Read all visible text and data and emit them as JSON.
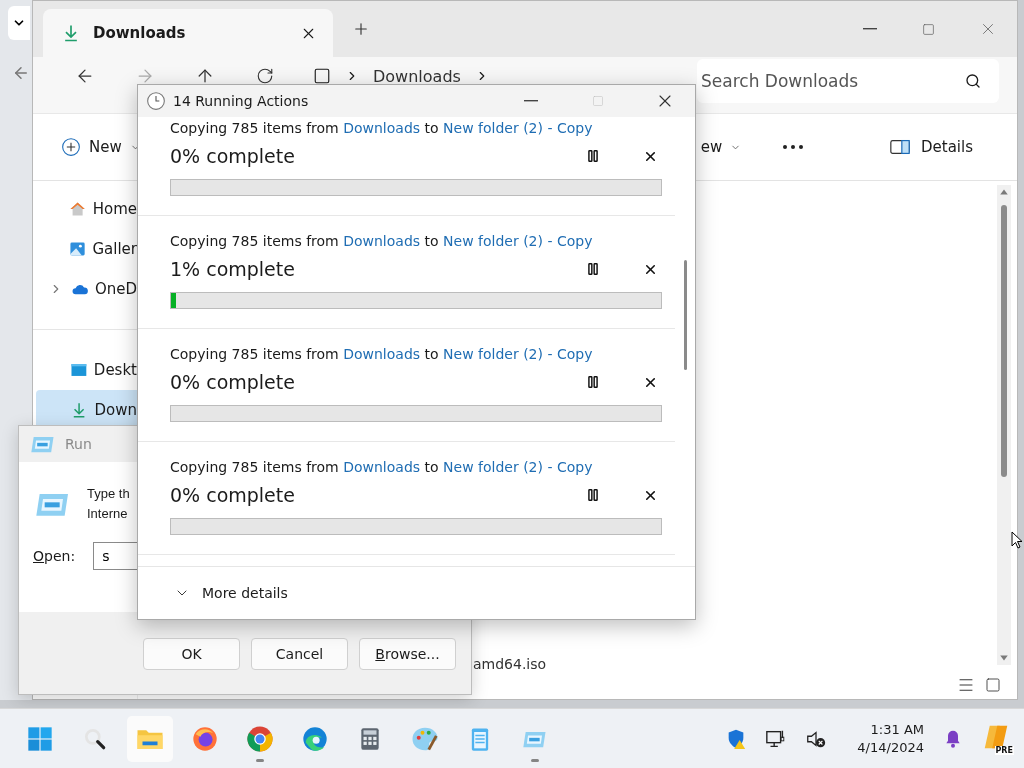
{
  "explorer": {
    "tab": {
      "label": "Downloads",
      "selected": true
    },
    "address": [
      "Downloads"
    ],
    "search": {
      "placeholder": "Search Downloads"
    },
    "commands": [
      {
        "kind": "new",
        "label": "New"
      },
      {
        "kind": "view",
        "label": "ew"
      }
    ],
    "details": "Details",
    "sidebar": {
      "groups": [
        {
          "items": [
            {
              "kind": "home",
              "label": "Home",
              "selected": false,
              "expandable": false
            },
            {
              "kind": "gallery",
              "label": "Galler",
              "selected": false,
              "expandable": false
            },
            {
              "kind": "cloud",
              "label": "OneD",
              "selected": false,
              "expandable": true
            }
          ]
        },
        {
          "items": [
            {
              "kind": "desktop",
              "label": "Deskt",
              "selected": false,
              "expandable": false
            },
            {
              "kind": "downloads",
              "label": "Down",
              "selected": true,
              "expandable": false
            }
          ]
        }
      ]
    },
    "files": [
      {
        "name": "amd64.iso"
      }
    ]
  },
  "run_dialog": {
    "title": "Run",
    "prompt_lines": [
      "Type th",
      "Interne"
    ],
    "open_label": {
      "text": "Open:",
      "first_letter_underlined": true
    },
    "open_value": "s",
    "buttons": [
      {
        "label": "OK"
      },
      {
        "label": "Cancel"
      },
      {
        "label": "Browse...",
        "first_letter_underlined": true
      }
    ]
  },
  "actions_dialog": {
    "title": "14 Running Actions",
    "items": [
      {
        "prefix": "Copying 785 items from",
        "source": "Downloads",
        "middle": "to",
        "destination": "New folder (2) - Copy",
        "percent": "0% complete",
        "level": 0
      },
      {
        "prefix": "Copying 785 items from",
        "source": "Downloads",
        "middle": "to",
        "destination": "New folder (2) - Copy",
        "percent": "1% complete",
        "level": 0.01
      },
      {
        "prefix": "Copying 785 items from",
        "source": "Downloads",
        "middle": "to",
        "destination": "New folder (2) - Copy",
        "percent": "0% complete",
        "level": 0
      },
      {
        "prefix": "Copying 785 items from",
        "source": "Downloads",
        "middle": "to",
        "destination": "New folder (2) - Copy",
        "percent": "0% complete",
        "level": 0
      }
    ],
    "more_details": "More details"
  },
  "taskbar": {
    "apps": [
      {
        "kind": "start",
        "active": false,
        "running": false
      },
      {
        "kind": "search",
        "active": false,
        "running": false
      },
      {
        "kind": "explorer",
        "active": true,
        "running": false
      },
      {
        "kind": "firefox",
        "active": false,
        "running": false
      },
      {
        "kind": "chrome",
        "active": false,
        "running": true
      },
      {
        "kind": "edge",
        "active": false,
        "running": false
      },
      {
        "kind": "calculator",
        "active": false,
        "running": false
      },
      {
        "kind": "paint",
        "active": false,
        "running": false
      },
      {
        "kind": "notepad",
        "active": false,
        "running": false
      },
      {
        "kind": "run",
        "active": false,
        "running": true
      }
    ],
    "time": "1:31 AM",
    "date": "4/14/2024",
    "badge": "PRE"
  }
}
